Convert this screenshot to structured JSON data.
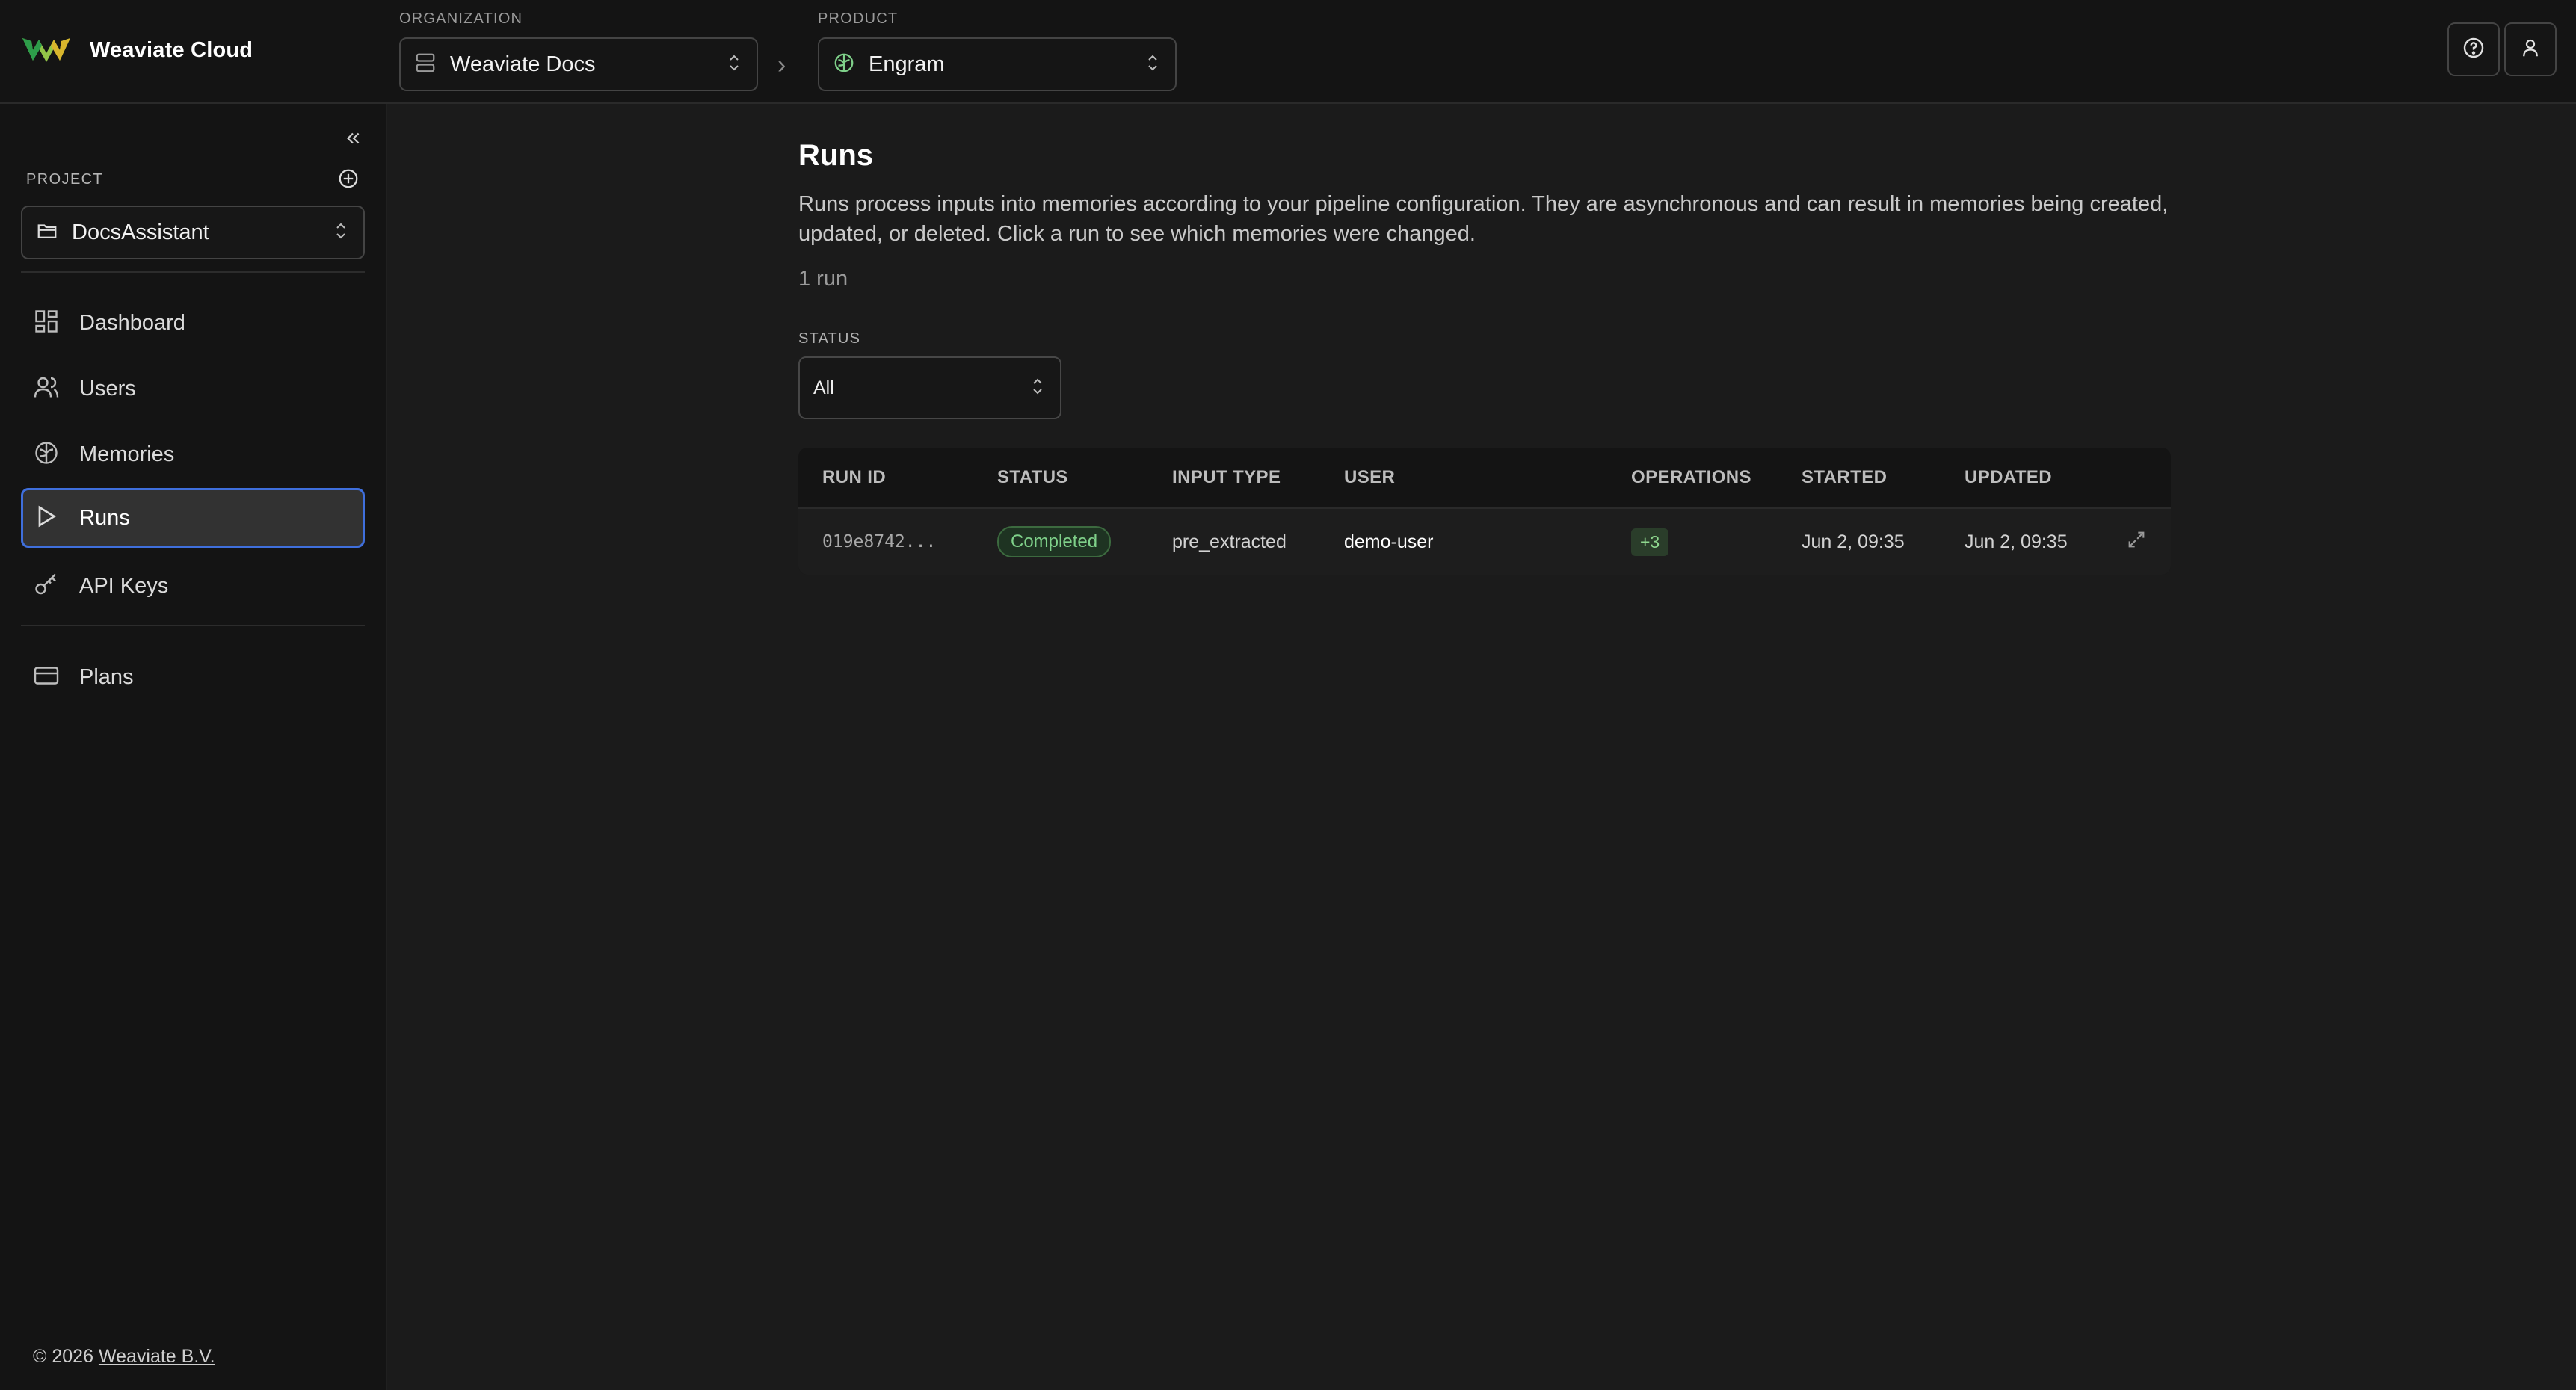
{
  "brand": {
    "name": "Weaviate Cloud"
  },
  "topbar": {
    "organization_caption": "ORGANIZATION",
    "organization_value": "Weaviate Docs",
    "product_caption": "PRODUCT",
    "product_value": "Engram",
    "breadcrumb_separator": "›",
    "help_icon": "help-circle-icon",
    "account_icon": "user-icon"
  },
  "sidebar": {
    "project_caption": "PROJECT",
    "project_value": "DocsAssistant",
    "items": [
      {
        "label": "Dashboard",
        "icon": "dashboard-icon",
        "active": false
      },
      {
        "label": "Users",
        "icon": "users-icon",
        "active": false
      },
      {
        "label": "Memories",
        "icon": "brain-icon",
        "active": false
      },
      {
        "label": "Runs",
        "icon": "play-icon",
        "active": true
      },
      {
        "label": "API Keys",
        "icon": "key-icon",
        "active": false
      },
      {
        "label": "Plans",
        "icon": "credit-card-icon",
        "active": false
      }
    ],
    "footer_prefix": "© 2026",
    "footer_link": "Weaviate B.V.",
    "accent_color": "#3f6fdc"
  },
  "main": {
    "title": "Runs",
    "description": "Runs process inputs into memories according to your pipeline configuration. They are asynchronous and can result in memories being created, updated, or deleted. Click a run to see which memories were changed.",
    "run_count": "1 run",
    "filter": {
      "caption": "STATUS",
      "value": "All"
    },
    "table": {
      "columns": [
        "RUN ID",
        "STATUS",
        "INPUT TYPE",
        "USER",
        "OPERATIONS",
        "STARTED",
        "UPDATED"
      ],
      "rows": [
        {
          "run_id": "019e8742...",
          "status": "Completed",
          "input_type": "pre_extracted",
          "user": "demo-user",
          "operations": "+3",
          "started": "Jun 2, 09:35",
          "updated": "Jun 2, 09:35"
        }
      ]
    }
  }
}
